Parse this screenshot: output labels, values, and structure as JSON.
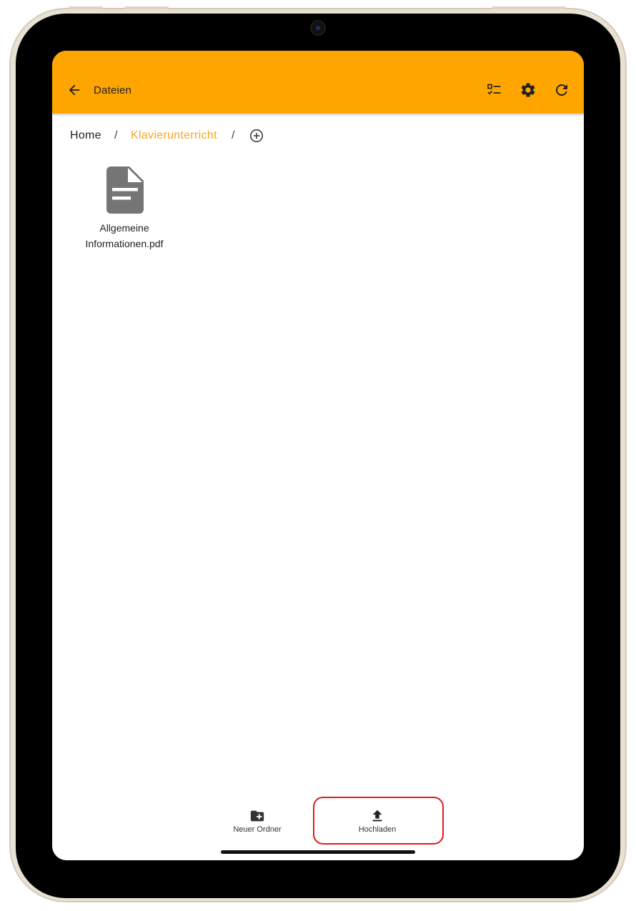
{
  "app_bar": {
    "title": "Dateien",
    "background_color": "#ffa500",
    "icons": [
      "arrow-back-icon",
      "checklist-icon",
      "gear-icon",
      "refresh-icon"
    ]
  },
  "breadcrumb": {
    "home": "Home",
    "separator": "/",
    "current": "Klavierunterricht",
    "current_color": "#f5a623",
    "add_icon": "add-circle-icon"
  },
  "files": [
    {
      "name": "Allgemeine Informationen.pdf",
      "icon": "document-icon"
    }
  ],
  "bottom_actions": [
    {
      "label": "Neuer Ordner",
      "icon": "create-folder-icon"
    },
    {
      "label": "Hochladen",
      "icon": "upload-icon",
      "highlighted": true
    }
  ],
  "highlight_color": "#e31b1b"
}
